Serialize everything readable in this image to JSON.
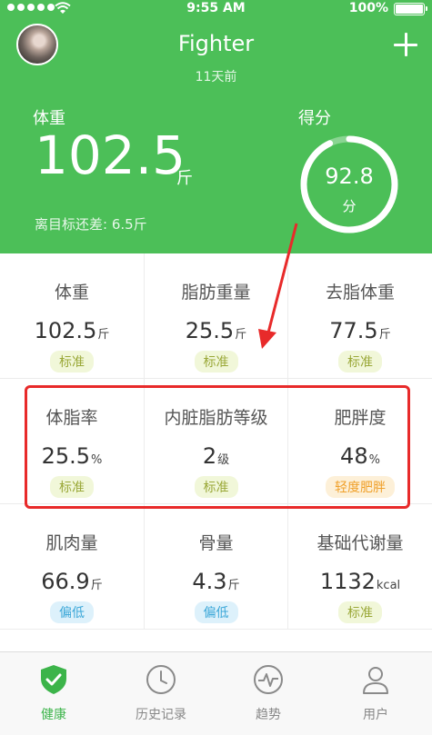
{
  "status_bar": {
    "time": "9:55 AM",
    "battery": "100%"
  },
  "header": {
    "title": "Fighter",
    "subtitle": "11天前",
    "weight_label": "体重",
    "weight_value": "102.5",
    "weight_unit": "斤",
    "remaining_text": "离目标还差: 6.5斤",
    "score_label": "得分",
    "score_value": "92.8",
    "score_unit": "分",
    "score_progress": 0.928
  },
  "metrics": [
    [
      {
        "label": "体重",
        "value": "102.5",
        "unit": "斤",
        "status": "标准",
        "status_type": "normal"
      },
      {
        "label": "脂肪重量",
        "value": "25.5",
        "unit": "斤",
        "status": "标准",
        "status_type": "normal"
      },
      {
        "label": "去脂体重",
        "value": "77.5",
        "unit": "斤",
        "status": "标准",
        "status_type": "normal"
      }
    ],
    [
      {
        "label": "体脂率",
        "value": "25.5",
        "unit": "%",
        "status": "标准",
        "status_type": "normal"
      },
      {
        "label": "内脏脂肪等级",
        "value": "2",
        "unit": "级",
        "status": "标准",
        "status_type": "normal"
      },
      {
        "label": "肥胖度",
        "value": "48",
        "unit": "%",
        "status": "轻度肥胖",
        "status_type": "warning"
      }
    ],
    [
      {
        "label": "肌肉量",
        "value": "66.9",
        "unit": "斤",
        "status": "偏低",
        "status_type": "low"
      },
      {
        "label": "骨量",
        "value": "4.3",
        "unit": "斤",
        "status": "偏低",
        "status_type": "low"
      },
      {
        "label": "基础代谢量",
        "value": "1132",
        "unit": "kcal",
        "status": "标准",
        "status_type": "normal"
      }
    ]
  ],
  "tabs": [
    {
      "label": "健康",
      "icon": "shield-check-icon",
      "active": true
    },
    {
      "label": "历史记录",
      "icon": "clock-icon",
      "active": false
    },
    {
      "label": "趋势",
      "icon": "heartbeat-icon",
      "active": false
    },
    {
      "label": "用户",
      "icon": "user-icon",
      "active": false
    }
  ],
  "colors": {
    "brand_green": "#4cbf58",
    "badge_normal_bg": "#f1f7d9",
    "badge_normal_text": "#9aa838",
    "badge_low_bg": "#ddf1fb",
    "badge_low_text": "#3ba7d8",
    "badge_warning_bg": "#fdf0d8",
    "badge_warning_text": "#f0a02a",
    "highlight": "#e82a2a"
  }
}
